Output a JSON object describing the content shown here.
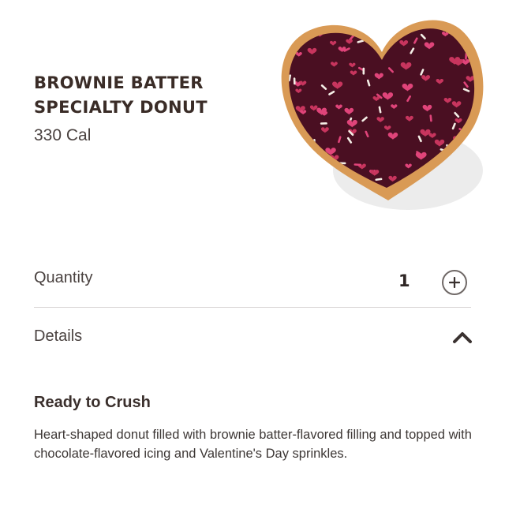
{
  "product": {
    "name_line1": "BROWNIE BATTER",
    "name_line2": "SPECIALTY DONUT",
    "calories": "330 Cal",
    "image_icon": "heart-donut-image"
  },
  "quantity": {
    "label": "Quantity",
    "value": "1",
    "increment_icon": "plus-circle-icon"
  },
  "details": {
    "label": "Details",
    "toggle_icon": "chevron-up-icon",
    "expanded": true,
    "heading": "Ready to Crush",
    "description": "Heart-shaped donut filled with brownie batter-flavored filling and topped with chocolate-flavored icing and Valentine's Day sprinkles."
  },
  "colors": {
    "icing": "#4a0f22",
    "dough": "#d99a55",
    "sprinkle_pink": "#e0447a",
    "sprinkle_white": "#f4eee6",
    "heart_sprinkle": "#c8355e"
  }
}
